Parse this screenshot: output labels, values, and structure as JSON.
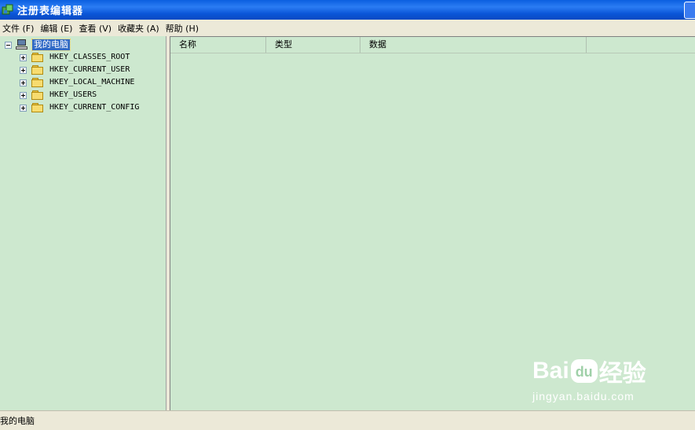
{
  "window": {
    "title": "注册表编辑器"
  },
  "menu": {
    "items": [
      {
        "label": "文件 (F)"
      },
      {
        "label": "编辑 (E)"
      },
      {
        "label": "查看 (V)"
      },
      {
        "label": "收藏夹 (A)"
      },
      {
        "label": "帮助 (H)"
      }
    ]
  },
  "tree": {
    "root": {
      "label": "我的电脑",
      "icon": "computer-icon",
      "expanded": true,
      "selected": true
    },
    "keys": [
      {
        "label": "HKEY_CLASSES_ROOT",
        "icon": "folder-icon"
      },
      {
        "label": "HKEY_CURRENT_USER",
        "icon": "folder-icon"
      },
      {
        "label": "HKEY_LOCAL_MACHINE",
        "icon": "folder-icon"
      },
      {
        "label": "HKEY_USERS",
        "icon": "folder-icon"
      },
      {
        "label": "HKEY_CURRENT_CONFIG",
        "icon": "folder-icon"
      }
    ]
  },
  "list": {
    "columns": [
      {
        "label": "名称"
      },
      {
        "label": "类型"
      },
      {
        "label": "数据"
      }
    ]
  },
  "status": {
    "text": "我的电脑"
  },
  "watermark": {
    "logo_left": "Bai",
    "logo_mid": "du",
    "logo_right": "经验",
    "url": "jingyan.baidu.com"
  },
  "colors": {
    "pane_background": "#cde8cf",
    "selection": "#316ac5",
    "titlebar": "#0a5fe0"
  }
}
